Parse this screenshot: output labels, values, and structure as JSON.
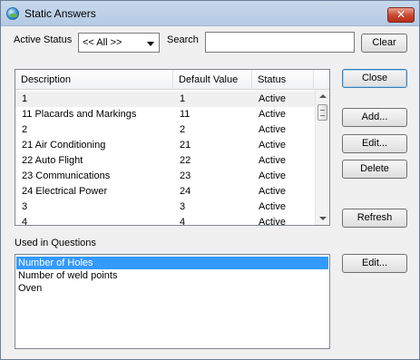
{
  "window": {
    "title": "Static Answers",
    "close_glyph": "✕"
  },
  "filters": {
    "active_status_label": "Active Status",
    "active_status_value": "<< All >>",
    "search_label": "Search",
    "search_value": "",
    "clear_label": "Clear"
  },
  "grid": {
    "columns": [
      "Description",
      "Default Value",
      "Status"
    ],
    "rows": [
      {
        "description": "1",
        "default_value": "1",
        "status": "Active"
      },
      {
        "description": "11 Placards and Markings",
        "default_value": "11",
        "status": "Active"
      },
      {
        "description": "2",
        "default_value": "2",
        "status": "Active"
      },
      {
        "description": "21 Air Conditioning",
        "default_value": "21",
        "status": "Active"
      },
      {
        "description": "22 Auto Flight",
        "default_value": "22",
        "status": "Active"
      },
      {
        "description": "23 Communications",
        "default_value": "23",
        "status": "Active"
      },
      {
        "description": "24 Electrical Power",
        "default_value": "24",
        "status": "Active"
      },
      {
        "description": "3",
        "default_value": "3",
        "status": "Active"
      },
      {
        "description": "4",
        "default_value": "4",
        "status": "Active"
      }
    ]
  },
  "side_buttons": {
    "close_label": "Close",
    "add_label": "Add...",
    "edit_label": "Edit...",
    "delete_label": "Delete",
    "refresh_label": "Refresh"
  },
  "questions": {
    "label": "Used in Questions",
    "items": [
      "Number of Holes",
      "Number of weld points",
      "Oven"
    ],
    "selected_index": 0,
    "edit_label": "Edit..."
  },
  "icons": {
    "app_icon": "globe-icon"
  }
}
